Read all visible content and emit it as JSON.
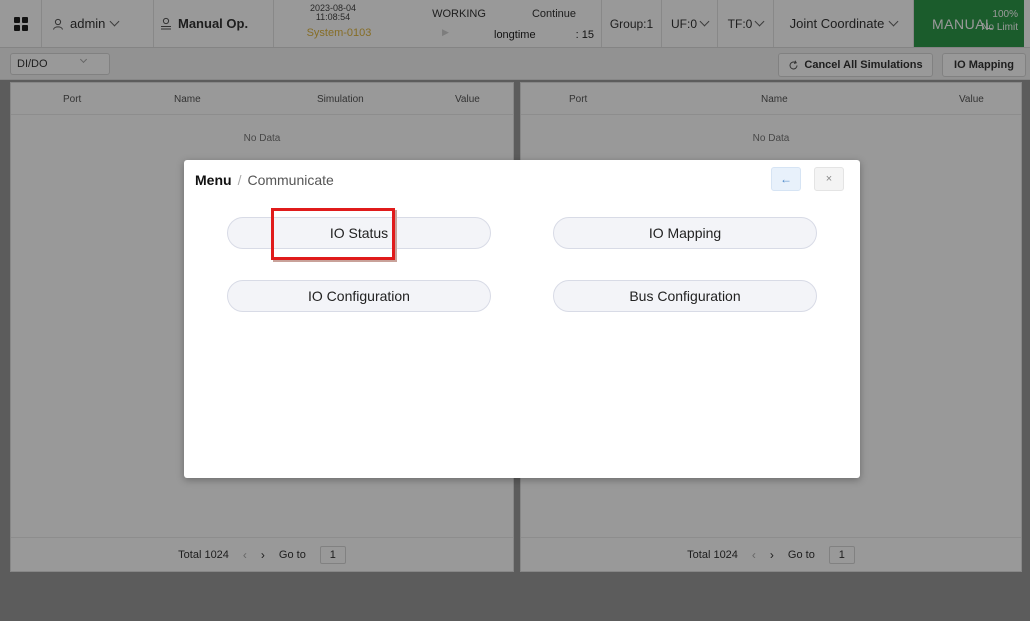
{
  "topbar": {
    "user": "admin",
    "op_mode": "Manual Op.",
    "date": "2023-08-04",
    "time": "11:08:54",
    "state": "WORKING",
    "continue_label": "Continue",
    "program": "System-0103",
    "longtime_label": "longtime",
    "count": ": 15",
    "group": "Group:1",
    "uf": "UF:0",
    "tf": "TF:0",
    "coordinate": "Joint Coordinate",
    "mode": "MANUAL",
    "speed": "100%",
    "limit": "No Limit",
    "mode_color": "#2d9a4a",
    "program_color": "#e0b640"
  },
  "subbar": {
    "io_type": "DI/DO",
    "cancel_sim_label": "Cancel All Simulations",
    "io_mapping_label": "IO Mapping"
  },
  "left_table": {
    "headers": [
      "Port",
      "Name",
      "Simulation",
      "Value"
    ],
    "empty_text": "No Data",
    "total": "Total 1024",
    "goto_label": "Go to",
    "page": "1"
  },
  "right_table": {
    "headers": [
      "Port",
      "Name",
      "Value"
    ],
    "empty_text": "No Data",
    "total": "Total 1024",
    "goto_label": "Go to",
    "page": "1"
  },
  "modal": {
    "crumb_root": "Menu",
    "crumb_sep": "/",
    "crumb_current": "Communicate",
    "back_icon": "←",
    "close_icon": "×",
    "buttons": [
      "IO Status",
      "IO Mapping",
      "IO Configuration",
      "Bus Configuration"
    ],
    "highlight_color": "#e01b1b"
  }
}
